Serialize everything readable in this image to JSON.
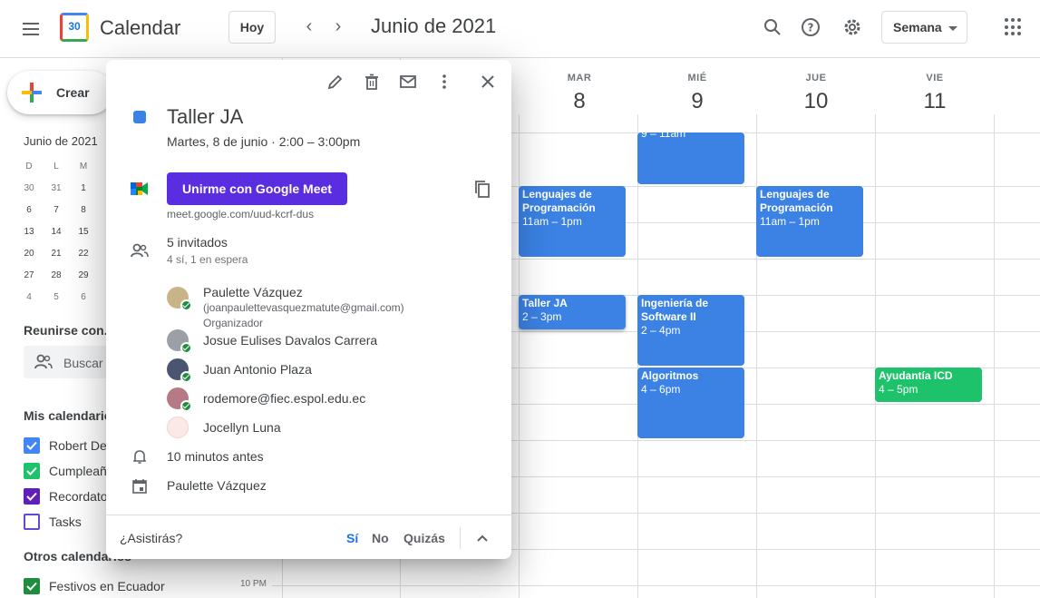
{
  "header": {
    "app_name": "Calendar",
    "logo_day": "30",
    "today_label": "Hoy",
    "month_title": "Junio de 2021",
    "view_label": "Semana",
    "icons": [
      "menu-icon",
      "search-icon",
      "help-icon",
      "settings-icon",
      "apps-icon"
    ]
  },
  "sidebar": {
    "create_label": "Crear",
    "mini_title": "Junio de 2021",
    "mini_weekdays": [
      "D",
      "L",
      "M"
    ],
    "mini_rows": [
      [
        "30",
        "31",
        "1"
      ],
      [
        "6",
        "7",
        "8"
      ],
      [
        "13",
        "14",
        "15"
      ],
      [
        "20",
        "21",
        "22"
      ],
      [
        "27",
        "28",
        "29"
      ],
      [
        "4",
        "5",
        "6"
      ]
    ],
    "meet_title": "Reunirse con...",
    "search_people": "Buscar",
    "my_calendars_title": "Mis calendarios",
    "my_calendars": [
      {
        "label": "Robert De",
        "color": "#4285f4",
        "checked": true
      },
      {
        "label": "Cumpleaño",
        "color": "#1ec26b",
        "checked": true
      },
      {
        "label": "Recordato",
        "color": "#5f1fb8",
        "checked": true
      },
      {
        "label": "Tasks",
        "color": "#5b4bd6",
        "checked": false
      }
    ],
    "other_calendars_title": "Otros calendarios",
    "other_calendars": [
      {
        "label": "Festivos en Ecuador",
        "color": "#1e8e3e",
        "checked": true
      }
    ]
  },
  "week": {
    "days": [
      {
        "name": "MAR",
        "num": "8"
      },
      {
        "name": "MIÉ",
        "num": "9"
      },
      {
        "name": "JUE",
        "num": "10"
      },
      {
        "name": "VIE",
        "num": "11"
      }
    ],
    "time_label": "10 PM",
    "events": [
      {
        "title": "",
        "time": "9 – 11am",
        "color": "blue"
      },
      {
        "title": "Lenguajes de Programación",
        "time": "11am – 1pm",
        "color": "blue"
      },
      {
        "title": "Lenguajes de Programación",
        "time": "11am – 1pm",
        "color": "blue"
      },
      {
        "title": "Taller JA",
        "time": "2 – 3pm",
        "color": "blue"
      },
      {
        "title": "Ingeniería de Software II",
        "time": "2 – 4pm",
        "color": "blue"
      },
      {
        "title": "Algoritmos",
        "time": "4 – 6pm",
        "color": "blue"
      },
      {
        "title": "Ayudantía ICD",
        "time": "4 – 5pm",
        "color": "green"
      }
    ]
  },
  "popup": {
    "title": "Taller JA",
    "date_line": "Martes, 8 de junio  ·  2:00 – 3:00pm",
    "meet_button": "Unirme con Google Meet",
    "meet_link": "meet.google.com/uud-kcrf-dus",
    "guests_count": "5 invitados",
    "guests_status": "4 sí, 1 en espera",
    "guests": [
      {
        "name": "Paulette Vázquez",
        "email": "(joanpaulettevasquezmatute@gmail.com)",
        "role": "Organizador",
        "accepted": true
      },
      {
        "name": "Josue Eulises Davalos Carrera",
        "accepted": true
      },
      {
        "name": "Juan Antonio Plaza",
        "accepted": true
      },
      {
        "name": "rodemore@fiec.espol.edu.ec",
        "accepted": true
      },
      {
        "name": "Jocellyn Luna",
        "accepted": false
      }
    ],
    "reminder": "10 minutos antes",
    "calendar_owner": "Paulette Vázquez",
    "rsvp_question": "¿Asistirás?",
    "rsvp_yes": "Sí",
    "rsvp_no": "No",
    "rsvp_maybe": "Quizás"
  }
}
